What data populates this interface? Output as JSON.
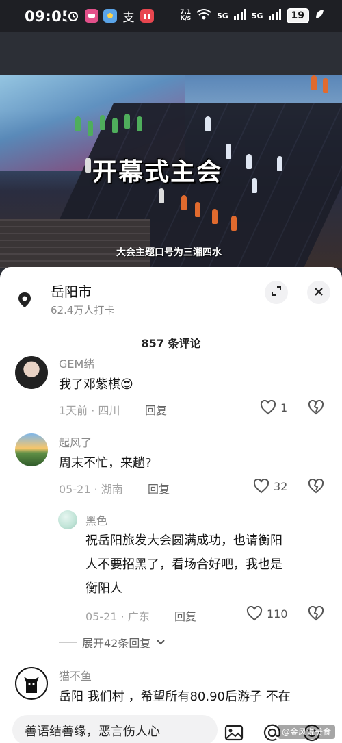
{
  "status": {
    "time": "09:05",
    "network_speed_top": "7.1",
    "network_speed_bottom": "K/s",
    "net1": "5G",
    "net2": "5G",
    "battery": "19",
    "alipay_glyph": "支"
  },
  "video": {
    "title_overlay": "开幕式主会",
    "subtitle_overlay": "大会主题口号为三湘四水"
  },
  "location": {
    "name": "岳阳市",
    "checkins": "62.4万人打卡"
  },
  "comments_header": "857 条评论",
  "comments": [
    {
      "user": "GEM绪",
      "text": "我了邓紫棋😍",
      "meta": "1天前 · 四川",
      "reply": "回复",
      "likes": "1"
    },
    {
      "user": "起风了",
      "text": "周末不忙，来趟?",
      "meta": "05-21 · 湖南",
      "reply": "回复",
      "likes": "32"
    },
    {
      "user": "黑色",
      "text_lines": [
        "祝岳阳旅发大会圆满成功，也请衡阳",
        "人不要招黑了，看场合好吧，我也是",
        "衡阳人"
      ],
      "meta": "05-21 · 广东",
      "reply": "回复",
      "likes": "110"
    },
    {
      "user": "猫不鱼",
      "text": "岳阳 我们村 ，希望所有80.90后游子 不在"
    }
  ],
  "expand_replies": "展开42条回复",
  "input": {
    "placeholder": "善语结善缘，恶言伤人心"
  },
  "watermark": "@金风说美食",
  "colors": {
    "status_bg": "#1e1f24",
    "sheet_bg": "#ffffff",
    "muted_text": "#8b8b8b"
  }
}
